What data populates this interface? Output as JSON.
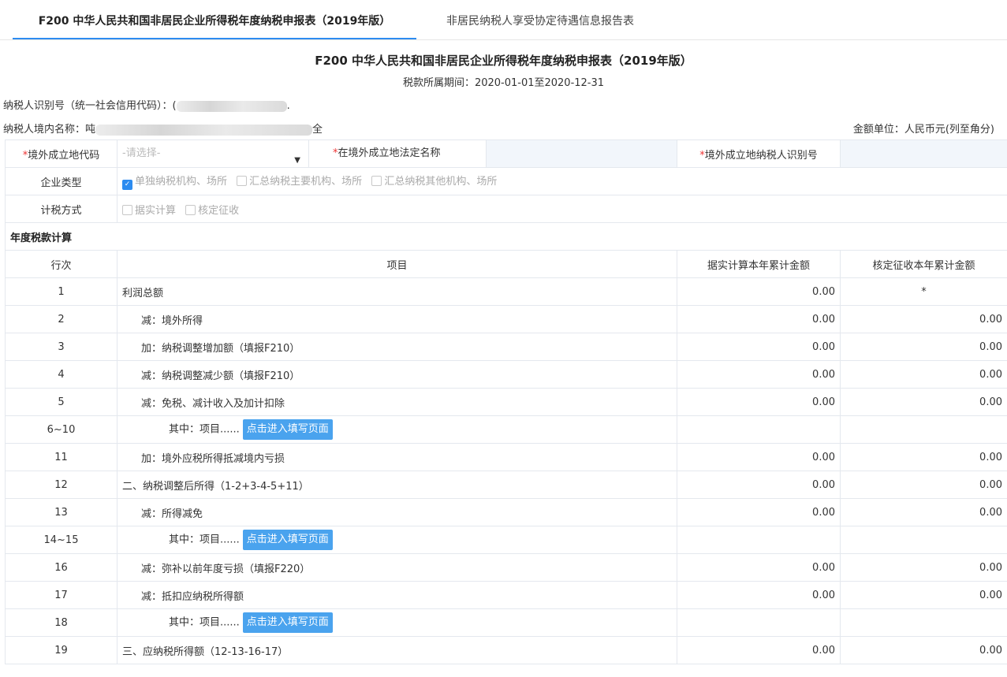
{
  "tabs": {
    "active": "F200 中华人民共和国非居民企业所得税年度纳税申报表（2019年版）",
    "second": "非居民纳税人享受协定待遇信息报告表"
  },
  "form": {
    "title": "F200 中华人民共和国非居民企业所得税年度纳税申报表（2019年版）",
    "period": "税款所属期间：2020-01-01至2020-12-31",
    "taxpayer_id_label": "纳税人识别号（统一社会信用代码）：",
    "taxpayer_id_value_prefix": "(",
    "taxpayer_id_value_suffix": ".",
    "taxpayer_name_label": "纳税人境内名称：",
    "taxpayer_name_prefix": "吨",
    "taxpayer_name_suffix": "全",
    "unit": "金额单位：人民币元(列至角分)"
  },
  "fields": {
    "required_mark": "*",
    "foreign_code_label": "境外成立地代码",
    "foreign_code_placeholder": "-请选择-",
    "legal_name_label": "在境外成立地法定名称",
    "foreign_taxid_label": "境外成立地纳税人识别号",
    "enterprise_type_label": "企业类型",
    "enterprise_options": [
      "单独纳税机构、场所",
      "汇总纳税主要机构、场所",
      "汇总纳税其他机构、场所"
    ],
    "method_label": "计税方式",
    "method_options": [
      "据实计算",
      "核定征收"
    ]
  },
  "section_title": "年度税款计算",
  "columns": [
    "行次",
    "项目",
    "据实计算本年累计金额",
    "核定征收本年累计金额"
  ],
  "button_label": "点击进入填写页面",
  "rows": [
    {
      "no": "1",
      "item": "利润总额",
      "a": "0.00",
      "b": "*"
    },
    {
      "no": "2",
      "item": "减：境外所得",
      "a": "0.00",
      "b": "0.00"
    },
    {
      "no": "3",
      "item": "加：纳税调整增加额（填报F210）",
      "a": "0.00",
      "b": "0.00"
    },
    {
      "no": "4",
      "item": "减：纳税调整减少额（填报F210）",
      "a": "0.00",
      "b": "0.00"
    },
    {
      "no": "5",
      "item": "减：免税、减计收入及加计扣除",
      "a": "0.00",
      "b": "0.00"
    },
    {
      "no": "6~10",
      "item": "其中：项目......",
      "a": "",
      "b": ""
    },
    {
      "no": "11",
      "item": "加：境外应税所得抵减境内亏损",
      "a": "0.00",
      "b": "0.00"
    },
    {
      "no": "12",
      "item": "二、纳税调整后所得（1-2+3-4-5+11）",
      "a": "0.00",
      "b": "0.00"
    },
    {
      "no": "13",
      "item": "减：所得减免",
      "a": "0.00",
      "b": "0.00"
    },
    {
      "no": "14~15",
      "item": "其中：项目......",
      "a": "",
      "b": ""
    },
    {
      "no": "16",
      "item": "减：弥补以前年度亏损（填报F220）",
      "a": "0.00",
      "b": "0.00"
    },
    {
      "no": "17",
      "item": "减：抵扣应纳税所得额",
      "a": "0.00",
      "b": "0.00"
    },
    {
      "no": "18",
      "item": "其中：项目......",
      "a": "",
      "b": ""
    },
    {
      "no": "19",
      "item": "三、应纳税所得额（12-13-16-17）",
      "a": "0.00",
      "b": "0.00"
    }
  ]
}
